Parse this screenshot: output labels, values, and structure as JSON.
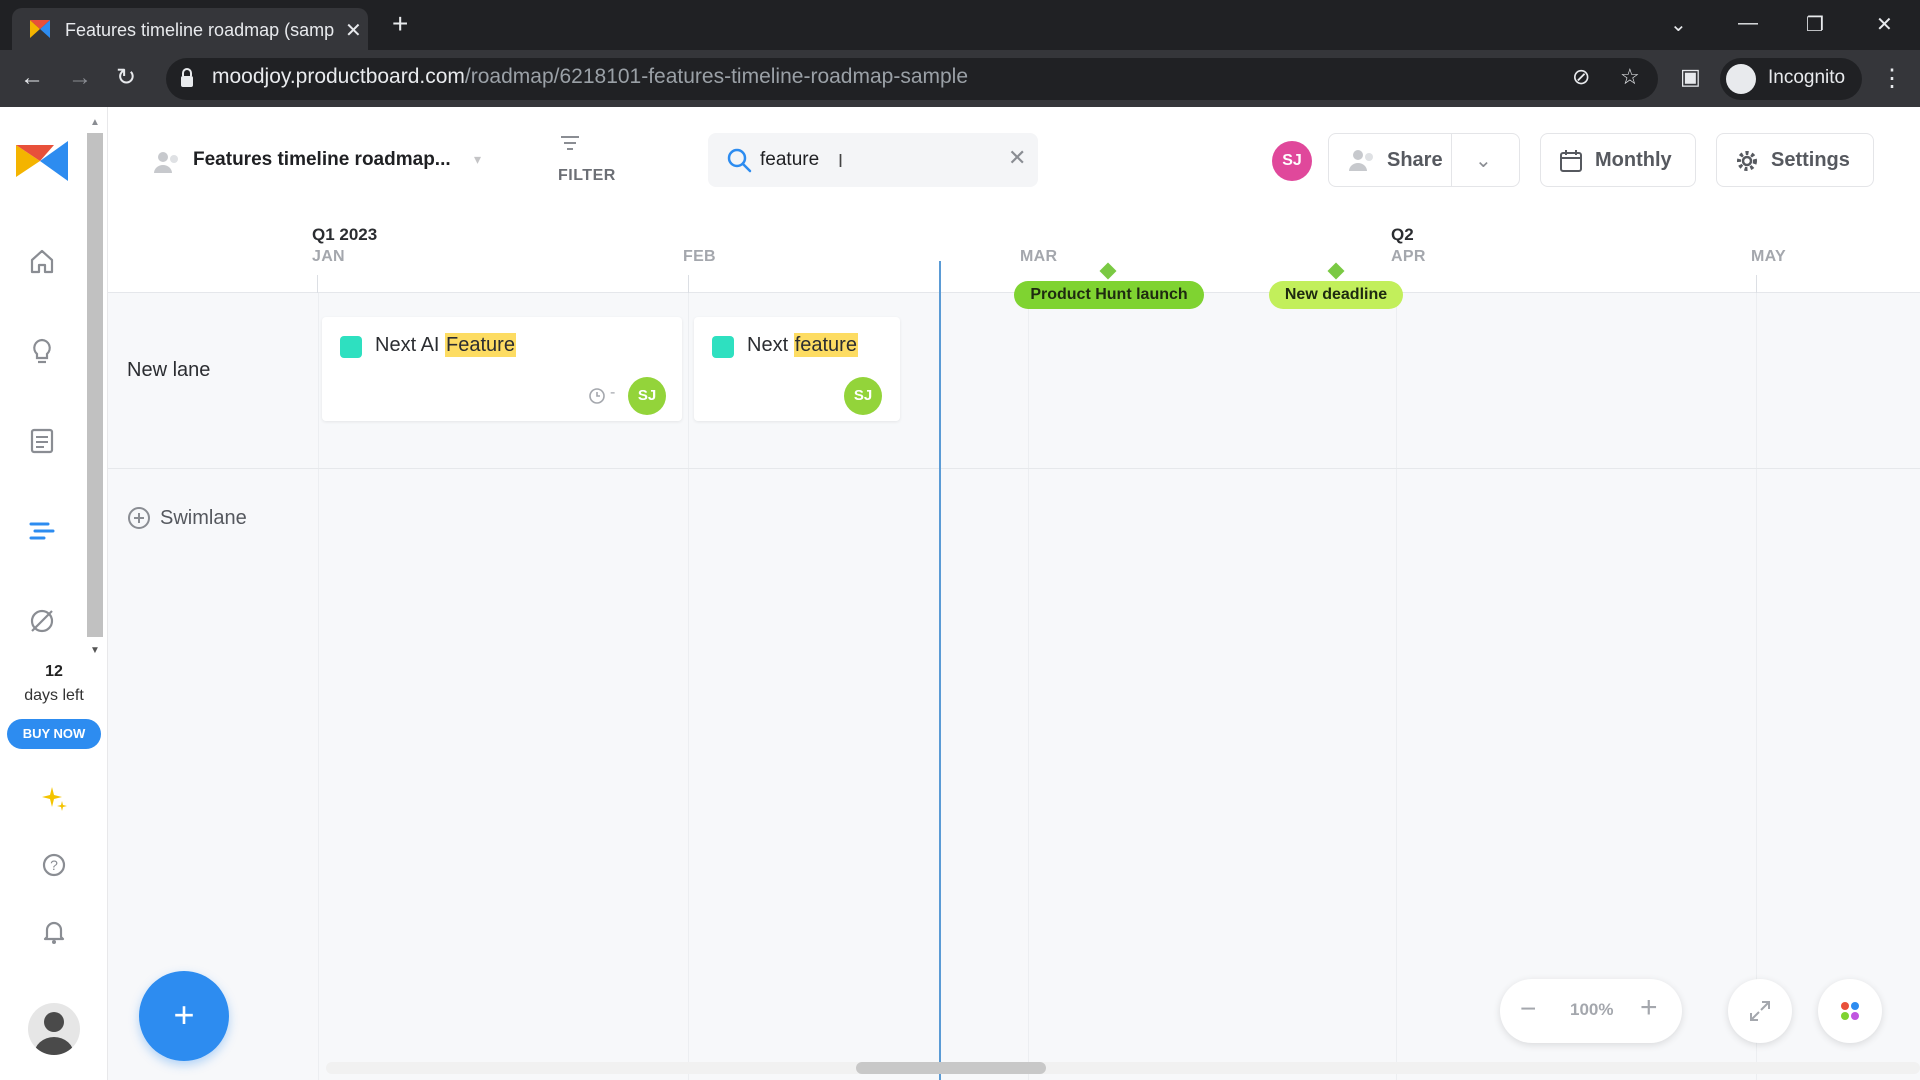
{
  "browser": {
    "tab_title": "Features timeline roadmap (samp",
    "tab_close": "✕",
    "new_tab": "+",
    "url_host": "moodjoy.productboard.com",
    "url_path": "/roadmap/6218101-features-timeline-roadmap-sample",
    "incognito_label": "Incognito"
  },
  "sidebar": {
    "trial_days": "12",
    "trial_label": "days left",
    "buy_label": "BUY NOW"
  },
  "toolbar": {
    "roadmap_title": "Features timeline roadmap...",
    "filter_label": "FILTER",
    "search": {
      "value": "feature",
      "clear": "✕"
    },
    "user_initials": "SJ",
    "share_label": "Share",
    "view_label": "Monthly",
    "settings_label": "Settings"
  },
  "timeline": {
    "quarters": [
      "Q1 2023",
      "Q2"
    ],
    "months": [
      "JAN",
      "FEB",
      "MAR",
      "APR",
      "MAY"
    ],
    "milestones": [
      "Product Hunt launch",
      "New deadline"
    ],
    "lanes": [
      {
        "name": "New lane",
        "cards": [
          {
            "prefix": "Next AI ",
            "match": "Feature",
            "dash": "-",
            "initials": "SJ"
          },
          {
            "prefix": "Next ",
            "match": "feature",
            "initials": "SJ"
          }
        ]
      }
    ],
    "add_swimlane_label": "Swimlane"
  },
  "zoom": {
    "minus": "−",
    "value": "100%",
    "plus": "+"
  },
  "fab_label": "+",
  "colors": {
    "accent": "#2d8cf0",
    "milestone": "#7fd331",
    "highlight": "#fddc62",
    "card_swatch": "#2ee0c0",
    "avatar_pink": "#e0489b",
    "avatar_green": "#93d43a"
  }
}
